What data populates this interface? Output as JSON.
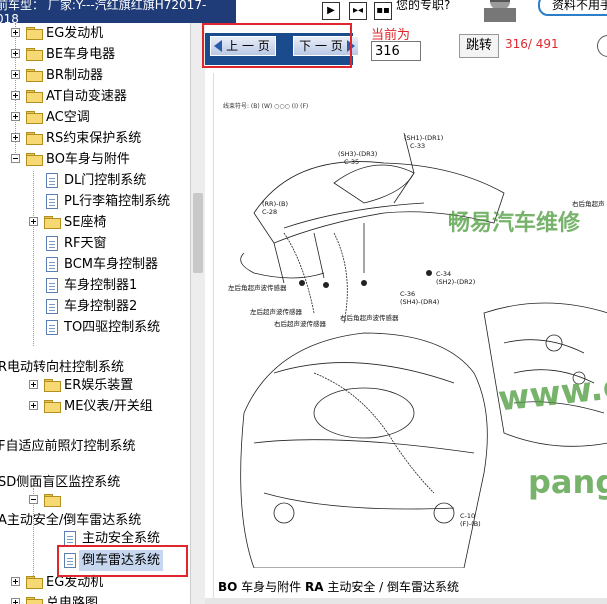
{
  "header": {
    "car_model_line1": "前车型：  厂家:Y---汽红旗红旗H72017-",
    "car_model_line2": "018",
    "question": "您的专职?",
    "extra": "资料不用手"
  },
  "tree": {
    "items": [
      {
        "label": "EG发动机"
      },
      {
        "label": "BE车身电器"
      },
      {
        "label": "BR制动器"
      },
      {
        "label": "AT自动变速器"
      },
      {
        "label": "AC空调"
      },
      {
        "label": "RS约束保护系统"
      },
      {
        "label": "BO车身与附件"
      },
      {
        "label": "DL门控制系统"
      },
      {
        "label": "PL行李箱控制系统"
      },
      {
        "label": "SE座椅"
      },
      {
        "label": "RF天窗"
      },
      {
        "label": "BCM车身控制器"
      },
      {
        "label": "车身控制器1"
      },
      {
        "label": "车身控制器2"
      },
      {
        "label": "TO四驱控制系统"
      },
      {
        "label": "R电动转向柱控制系统"
      },
      {
        "label": "ER娱乐装置"
      },
      {
        "label": "ME仪表/开关组"
      },
      {
        "label": "F自适应前照灯控制系统"
      },
      {
        "label": "SD侧面盲区监控系统"
      },
      {
        "label": ""
      },
      {
        "label": "A主动安全/倒车雷达系统"
      },
      {
        "label": "主动安全系统"
      },
      {
        "label": "倒车雷达系统"
      },
      {
        "label": "EG发动机"
      },
      {
        "label": "总电路图"
      }
    ]
  },
  "toolbar": {
    "prev_label": "上 一 页",
    "next_label": "下 一 页",
    "current_label": "当前为",
    "current_page": "316",
    "jump_label": "跳转",
    "page_count": "316/ 491"
  },
  "document": {
    "legend": "线束符号:      (B)      (W)  ○○○ (I)      (F)",
    "watermark1": "畅易汽车维修",
    "watermark2": "www.c",
    "watermark3": "pang",
    "footer_bold1": "BO",
    "footer_text1": " 车身与附件  ",
    "footer_bold2": "RA",
    "footer_text2": " 主动安全 / 倒车雷达系统",
    "connectors": {
      "c33": "(SH1)-(DR1)",
      "c33b": "C-33",
      "c35": "(SH3)-(DR3)",
      "c35b": "C-35",
      "c28": "(RR)-(B)",
      "c28b": "C-28",
      "c34": "C-34",
      "c34b": "(SH2)-(DR2)",
      "c36": "C-36",
      "c36b": "(SH4)-(DR4)",
      "c10": "C-10",
      "c10b": "(F)-(B)",
      "s1": "左后角超声波传感器",
      "s2": "左后超声波传感器",
      "s3": "右后超声波传感器",
      "s4": "右后角超声波传感器",
      "s5": "右后角超声"
    }
  }
}
